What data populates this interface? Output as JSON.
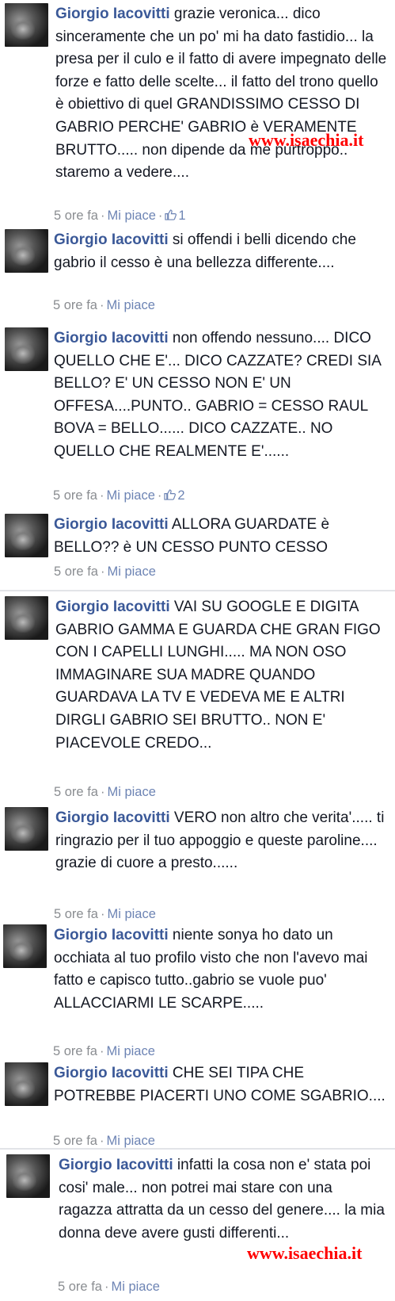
{
  "comments": [
    {
      "author": "Giorgio Iacovitti",
      "text": "grazie veronica... dico sinceramente che un po' mi ha dato fastidio... la presa per il culo e il fatto di avere impegnato delle forze e fatto delle scelte... il fatto del trono quello è obiettivo di quel GRANDISSIMO CESSO DI GABRIO PERCHE' GABRIO è VERAMENTE BRUTTO..... non dipende da me purtroppo.. staremo a vedere....",
      "time": "5 ore fa",
      "like_label": "Mi piace",
      "like_count": "1"
    },
    {
      "author": "Giorgio Iacovitti",
      "text": "si offendi i belli dicendo che gabrio il cesso è una bellezza differente....",
      "time": "5 ore fa",
      "like_label": "Mi piace"
    },
    {
      "author": "Giorgio Iacovitti",
      "text": "non offendo nessuno.... DICO QUELLO CHE E'... DICO CAZZATE? CREDI SIA BELLO? E' UN CESSO NON E' UN OFFESA....PUNTO.. GABRIO = CESSO RAUL BOVA = BELLO...... DICO CAZZATE.. NO QUELLO CHE REALMENTE E'......",
      "time": "5 ore fa",
      "like_label": "Mi piace",
      "like_count": "2"
    },
    {
      "author": "Giorgio Iacovitti",
      "text": "ALLORA GUARDATE è BELLO?? è UN CESSO PUNTO CESSO",
      "time": "5 ore fa",
      "like_label": "Mi piace"
    },
    {
      "author": "Giorgio Iacovitti",
      "text": "VAI SU GOOGLE E DIGITA GABRIO GAMMA E GUARDA CHE GRAN FIGO CON I CAPELLI LUNGHI..... MA NON OSO IMMAGINARE SUA MADRE QUANDO GUARDAVA LA TV E VEDEVA ME E ALTRI DIRGLI GABRIO SEI BRUTTO.. NON E' PIACEVOLE CREDO...",
      "time": "5 ore fa",
      "like_label": "Mi piace"
    },
    {
      "author": "Giorgio Iacovitti",
      "text": "VERO non altro che verita'..... ti ringrazio per il tuo appoggio e queste paroline.... grazie di cuore a presto......",
      "time": "5 ore fa",
      "like_label": "Mi piace"
    },
    {
      "author": "Giorgio Iacovitti",
      "text": "niente sonya ho dato un occhiata al tuo profilo visto che non l'avevo mai fatto e capisco tutto..gabrio se vuole puo' ALLACCIARMI LE SCARPE.....",
      "time": "5 ore fa",
      "like_label": "Mi piace"
    },
    {
      "author": "Giorgio Iacovitti",
      "text": "CHE SEI TIPA CHE POTREBBE PIACERTI UNO COME SGABRIO....",
      "time": "5 ore fa",
      "like_label": "Mi piace"
    },
    {
      "author": "Giorgio Iacovitti",
      "text": "infatti la cosa non e' stata poi cosi' male... non potrei mai stare con una ragazza attratta da un cesso del genere.... la mia donna deve avere gusti differenti...",
      "time": "5 ore fa",
      "like_label": "Mi piace"
    }
  ],
  "meta_separator": "·",
  "watermark_text": "www.isaechia.it",
  "colors": {
    "author": "#3b5998",
    "link": "#6d84b4",
    "meta": "#8a8d91",
    "watermark": "#ff0000"
  }
}
